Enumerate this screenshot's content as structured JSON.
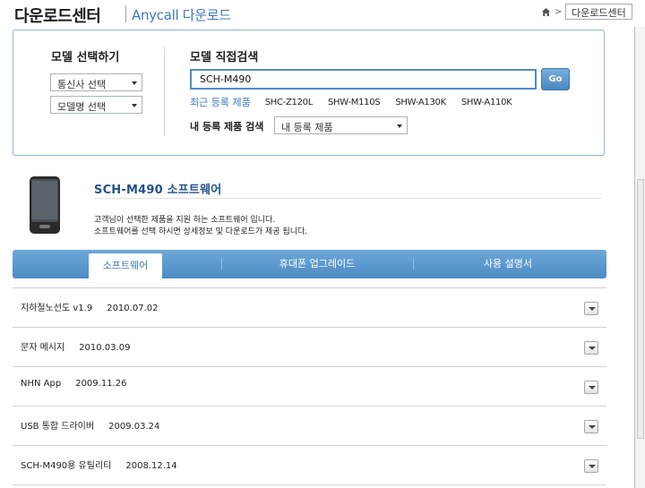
{
  "header": {
    "title": "다운로드센터",
    "subtitle": "Anycall 다운로드",
    "breadcrumb_select": "다운로드센터"
  },
  "model_select": {
    "title": "모델 선택하기",
    "carrier_select": "통신사 선택",
    "model_name_select": "모델명 선택"
  },
  "direct_search": {
    "title": "모델 직접검색",
    "input_value": "SCH-M490",
    "go_label": "Go",
    "recent_label": "최근 등록 제품",
    "recent_items": [
      "SHC-Z120L",
      "SHW-M110S",
      "SHW-A130K",
      "SHW-A110K"
    ],
    "my_products_label": "내 등록 제품 검색",
    "my_products_select": "내 등록 제품"
  },
  "product": {
    "title": "SCH-M490 소프트웨어",
    "desc_line1": "고객님이 선택한 제품을 지원 하는 소프트웨어 입니다.",
    "desc_line2": "소프트웨어를 선택 하시면 상세정보 및 다운로드가 제공 됩니다."
  },
  "tabs": {
    "software": "소프트웨어",
    "upgrade": "휴대폰 업그레이드",
    "manual": "사용 설명서"
  },
  "software_list": [
    {
      "name": "지하철노선도 v1.9",
      "date": "2010.07.02"
    },
    {
      "name": "문자 메시지",
      "date": "2010.03.09"
    },
    {
      "name": "NHN App",
      "date": "2009.11.26"
    },
    {
      "name": "USB 통합 드라이버",
      "date": "2009.03.24"
    },
    {
      "name": "SCH-M490용 유틸리티",
      "date": "2008.12.14"
    }
  ],
  "colors": {
    "accent_blue": "#3d79b6",
    "tab_bar": "#5a97cc",
    "panel_border": "#8fb5d6"
  },
  "icons": [
    "home-icon",
    "chevron-right-icon",
    "dropdown-arrow-icon",
    "phone-image",
    "expand-arrow-icon"
  ]
}
